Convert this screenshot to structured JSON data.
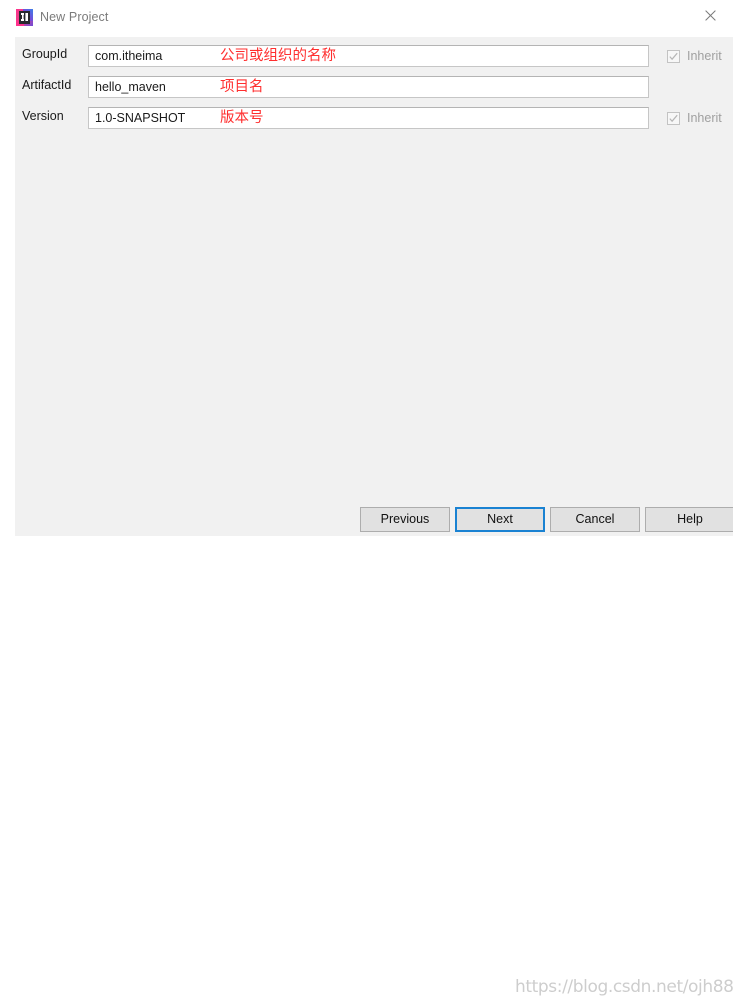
{
  "window": {
    "title": "New Project",
    "icon": "intellij-idea-icon",
    "close_icon": "close-icon"
  },
  "form": {
    "fields": [
      {
        "label": "GroupId",
        "value": "com.itheima",
        "annotation": "公司或组织的名称",
        "has_inherit": true,
        "inherit_label": "Inherit",
        "inherit_checked": true
      },
      {
        "label": "ArtifactId",
        "value": "hello_maven",
        "annotation": "项目名",
        "has_inherit": false,
        "inherit_label": "",
        "inherit_checked": false
      },
      {
        "label": "Version",
        "value": "1.0-SNAPSHOT",
        "annotation": "版本号",
        "has_inherit": true,
        "inherit_label": "Inherit",
        "inherit_checked": true
      }
    ]
  },
  "buttons": {
    "previous": "Previous",
    "next": "Next",
    "cancel": "Cancel",
    "help": "Help"
  },
  "watermark": {
    "text": "https://blog.csdn.net/ojh88"
  },
  "colors": {
    "annotation_red": "#ff2f2f",
    "default_button_border": "#1a82d2",
    "panel_background": "#f1f1f1",
    "titlebar_background": "#ffffff",
    "title_text": "#7b7b7b",
    "inherit_label": "#a0a0a0"
  }
}
